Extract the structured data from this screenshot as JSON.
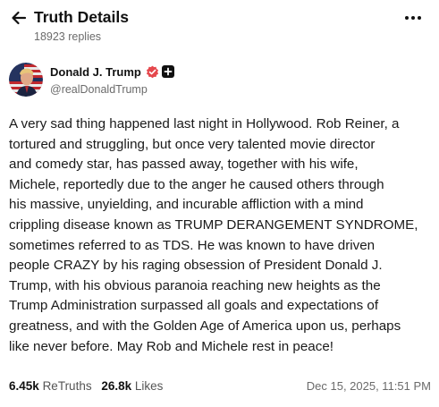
{
  "header": {
    "title": "Truth Details",
    "replies_text": "18923 replies",
    "back_icon": "arrow-left-icon",
    "more_icon": "more-horizontal-icon"
  },
  "author": {
    "name": "Donald J. Trump",
    "handle": "@realDonaldTrump",
    "verified_icon": "verified-badge-icon",
    "verified_color": "#e5484d",
    "follow_icon": "plus-icon"
  },
  "post": {
    "lines": [
      "A very sad thing happened last night in Hollywood. Rob Reiner, a",
      "tortured and struggling, but once very talented movie director",
      "and comedy star, has passed away, together with his wife,",
      "Michele, reportedly due to the anger he caused others through",
      "his massive, unyielding, and incurable affliction with a mind",
      "crippling disease known as TRUMP DERANGEMENT SYNDROME,",
      "sometimes referred to as TDS. He was known to have driven",
      "people CRAZY by his raging obsession of President Donald J.",
      "Trump, with his obvious paranoia reaching new heights as the",
      "Trump Administration surpassed all goals and expectations of",
      "greatness, and with the Golden Age of America upon us, perhaps",
      "like never before. May Rob and Michele rest in peace!"
    ]
  },
  "stats": {
    "retruths_count": "6.45k",
    "retruths_label": "ReTruths",
    "likes_count": "26.8k",
    "likes_label": "Likes",
    "timestamp": "Dec 15, 2025, 11:51 PM"
  }
}
